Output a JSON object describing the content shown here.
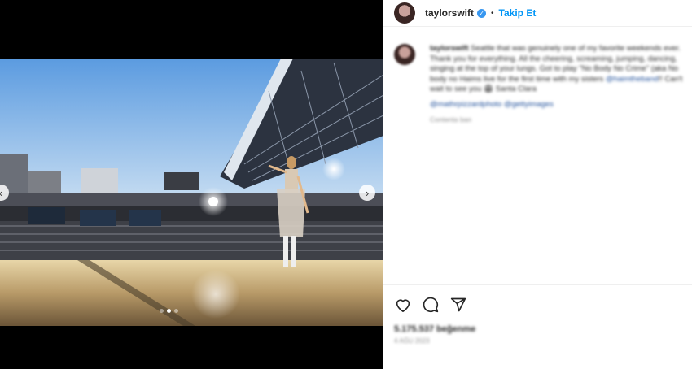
{
  "post": {
    "username": "taylorswift",
    "follow_label": "Takip Et",
    "separator": "•",
    "caption_user": "taylorswift",
    "caption_text": "Seattle that was genuinely one of my favorite weekends ever. Thank you for everything. All the cheering, screaming, jumping, dancing, singing at the top of your lungs. Got to play \"No Body No Crime\" (aka No body no Haims live for the first time with my sisters",
    "caption_mention": "@haimtheband",
    "caption_end": "!! Can't wait to see you 🏟 Santa Clara",
    "photo_credit_line": "@mathrpizzardphoto @gettyimages",
    "photo_credit_sub": "Contenta ban",
    "likes_text": "5.175.537 beğenme",
    "date_text": "4 AĞU 2023"
  },
  "icons": {
    "verified": "verified-badge-icon",
    "like": "heart-icon",
    "comment": "comment-icon",
    "share": "paper-plane-icon",
    "prev": "chevron-left-icon",
    "next": "chevron-right-icon"
  },
  "colors": {
    "follow": "#0095f6",
    "verified": "#3897f0",
    "sky": "#4a90d8"
  },
  "carousel": {
    "count": 3,
    "active_index": 1
  }
}
